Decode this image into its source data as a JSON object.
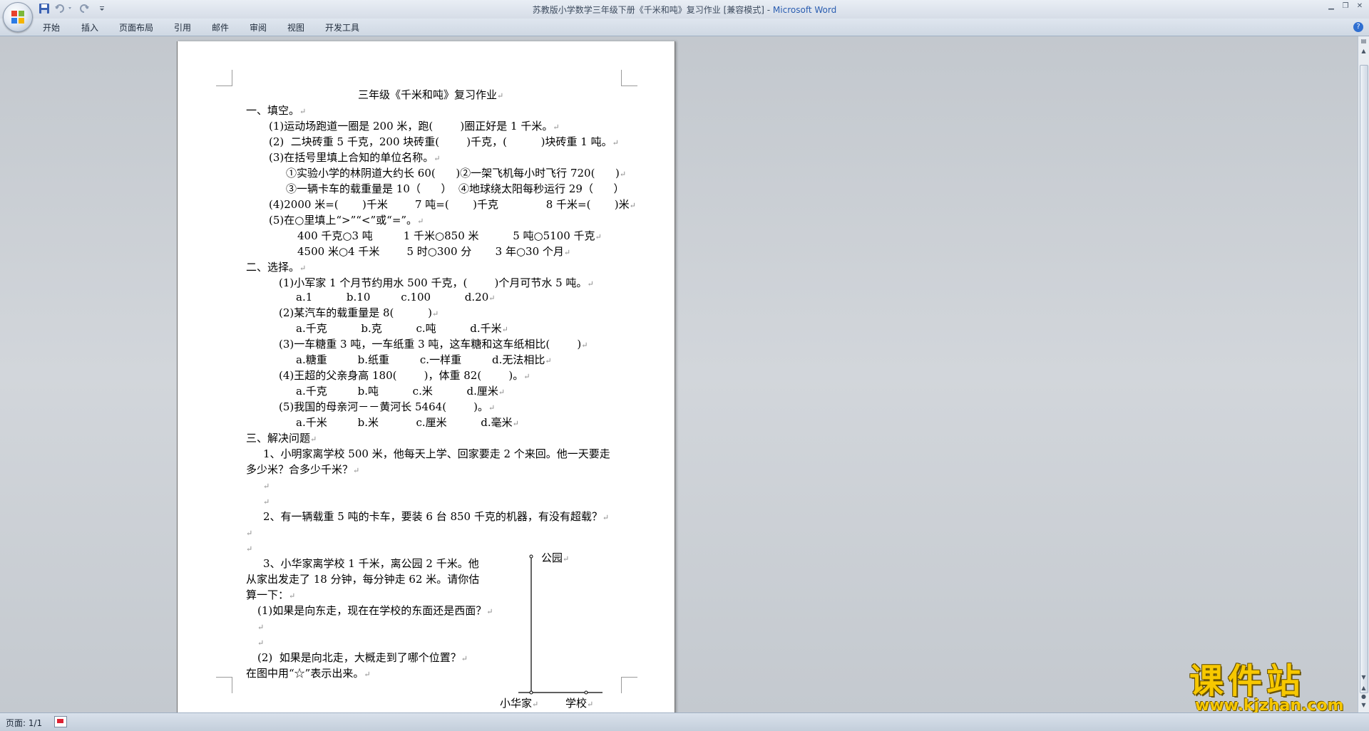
{
  "window": {
    "title": "苏教版小学数学三年级下册《千米和吨》复习作业 [兼容模式] - ",
    "app_name": "Microsoft Word"
  },
  "ribbon": {
    "tabs": [
      "开始",
      "插入",
      "页面布局",
      "引用",
      "邮件",
      "审阅",
      "视图",
      "开发工具"
    ]
  },
  "document": {
    "title": "三年级《千米和吨》复习作业",
    "s1_heading": "一、填空。",
    "s1_q1": "(1)运动场跑道一圈是 200 米，跑(        )圈正好是 1 千米。",
    "s1_q2": "(2)  二块砖重 5 千克，200 块砖重(        )千克，(          )块砖重 1 吨。",
    "s1_q3": "(3)在括号里填上合知的单位名称。",
    "s1_q3a": "①实验小学的林阴道大约长 60(      )②一架飞机每小时飞行 720(      )",
    "s1_q3b": "③一辆卡车的载重量是 10（      ）  ④地球绕太阳每秒运行 29（      ）",
    "s1_q4": "(4)2000 米=(       )千米        7 吨=(       )千克              8 千米=(       )米",
    "s1_q5": "(5)在○里填上“>”“<”或“=”。",
    "s1_q5a": "400 千克○3 吨         1 千米○850 米          5 吨○5100 千克",
    "s1_q5b": "4500 米○4 千米        5 时○300 分       3 年○30 个月",
    "s2_heading": "二、选择。",
    "s2_q1": "(1)小军家 1 个月节约用水 500 千克，(        )个月可节水 5 吨。",
    "s2_q1_opts": "a.1          b.10         c.100          d.20",
    "s2_q2": "(2)某汽车的载重量是 8(          )",
    "s2_q2_opts": "a.千克          b.克          c.吨          d.千米",
    "s2_q3": "(3)一车糖重 3 吨，一车纸重 3 吨，这车糖和这车纸相比(        )",
    "s2_q3_opts": "a.糖重         b.纸重         c.一样重         d.无法相比",
    "s2_q4": "(4)王超的父亲身高 180(        )，体重 82(        )。",
    "s2_q4_opts": "a.千克         b.吨          c.米          d.厘米",
    "s2_q5": "(5)我国的母亲河－－黄河长 5464(        )。",
    "s2_q5_opts": "a.千米         b.米           c.厘米          d.毫米",
    "s3_heading": "三、解决问题",
    "s3_p1_l1": "1、小明家离学校 500 米，他每天上学、回家要走 2 个来回。他一天要走",
    "s3_p1_l2": "多少米？合多少千米？",
    "s3_p2": "2、有一辆载重 5 吨的卡车，要装 6 台 850 千克的机器，有没有超载？",
    "s3_p3_l1": "3、小华家离学校 1 千米，离公园 2 千米。他",
    "s3_p3_l2": "从家出发走了 18 分钟，每分钟走 62 米。请你估",
    "s3_p3_l3": "算一下：",
    "s3_p3_q1": "(1)如果是向东走，现在在学校的东面还是西面？",
    "s3_p3_q2": "(2)  如果是向北走，大概走到了哪个位置？",
    "s3_p3_q2b": "在图中用“☆”表示出来。",
    "diagram_park": "公园",
    "diagram_home": "小华家",
    "diagram_school": "学校",
    "para_mark": "↵"
  },
  "status": {
    "page_info": "页面: 1/1"
  },
  "watermark": {
    "top": "课件站",
    "bottom": "www.kjzhan.com"
  },
  "colors": {
    "title_app": "#2a5db0",
    "watermark": "#f7c800"
  }
}
